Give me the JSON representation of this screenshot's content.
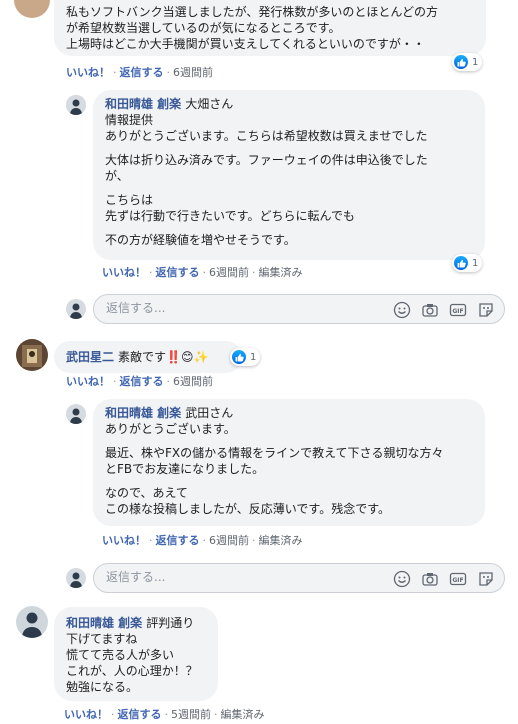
{
  "colors": {
    "link": "#4267b2",
    "name": "#385898",
    "bubble": "#f2f3f5",
    "meta": "#606770",
    "like": "#1877f2"
  },
  "top_comment": {
    "lines": [
      "私もソフトバンク当選しましたが、発行株数が多いのとほとんどの方",
      "が希望枚数当選しているのが気になるところです。",
      "上場時はどこか大手機関が買い支えしてくれるといいのですが・・"
    ],
    "like": "いいね！",
    "reply": "返信する",
    "time": "6週間前",
    "reaction_count": "1"
  },
  "reply1": {
    "author": "和田晴雄 創楽",
    "tagged": "大畑さん",
    "lines": [
      "情報提供",
      "ありがとうございます。こちらは希望枚数は買えませでした",
      "",
      "大体は折り込み済みです。ファーウェイの件は申込後でした",
      "が、",
      "",
      "こちらは",
      "先ずは行動で行きたいです。どちらに転んでも",
      "",
      "不の方が経験値を増やせそうです。"
    ],
    "like": "いいね！",
    "reply": "返信する",
    "time": "6週間前",
    "edited": "編集済み",
    "reaction_count": "1"
  },
  "reply_box_1": {
    "placeholder": "返信する..."
  },
  "comment2": {
    "author": "武田星二",
    "text": "素敵です‼️😊✨",
    "like": "いいね！",
    "reply": "返信する",
    "time": "6週間前",
    "reaction_count": "1"
  },
  "reply2": {
    "author": "和田晴雄 創楽",
    "tagged": "武田さん",
    "lines": [
      "ありがとうございます。",
      "",
      "最近、株やFXの儲かる情報をラインで教えて下さる親切な方々",
      "とFBでお友達になりました。",
      "",
      "なので、あえて",
      "この様な投稿しましたが、反応薄いです。残念です。"
    ],
    "like": "いいね！",
    "reply": "返信する",
    "time": "6週間前",
    "edited": "編集済み"
  },
  "reply_box_2": {
    "placeholder": "返信する..."
  },
  "comment3": {
    "author": "和田晴雄 創楽",
    "first_line": "評判通り",
    "lines": [
      "下げてますね",
      "慌てて売る人が多い",
      "これが、人の心理か！？",
      "勉強になる。"
    ],
    "like": "いいね！",
    "reply": "返信する",
    "time": "5週間前",
    "edited": "編集済み"
  },
  "icons": [
    "like-icon",
    "emoji-icon",
    "camera-icon",
    "gif-icon",
    "sticker-icon"
  ]
}
